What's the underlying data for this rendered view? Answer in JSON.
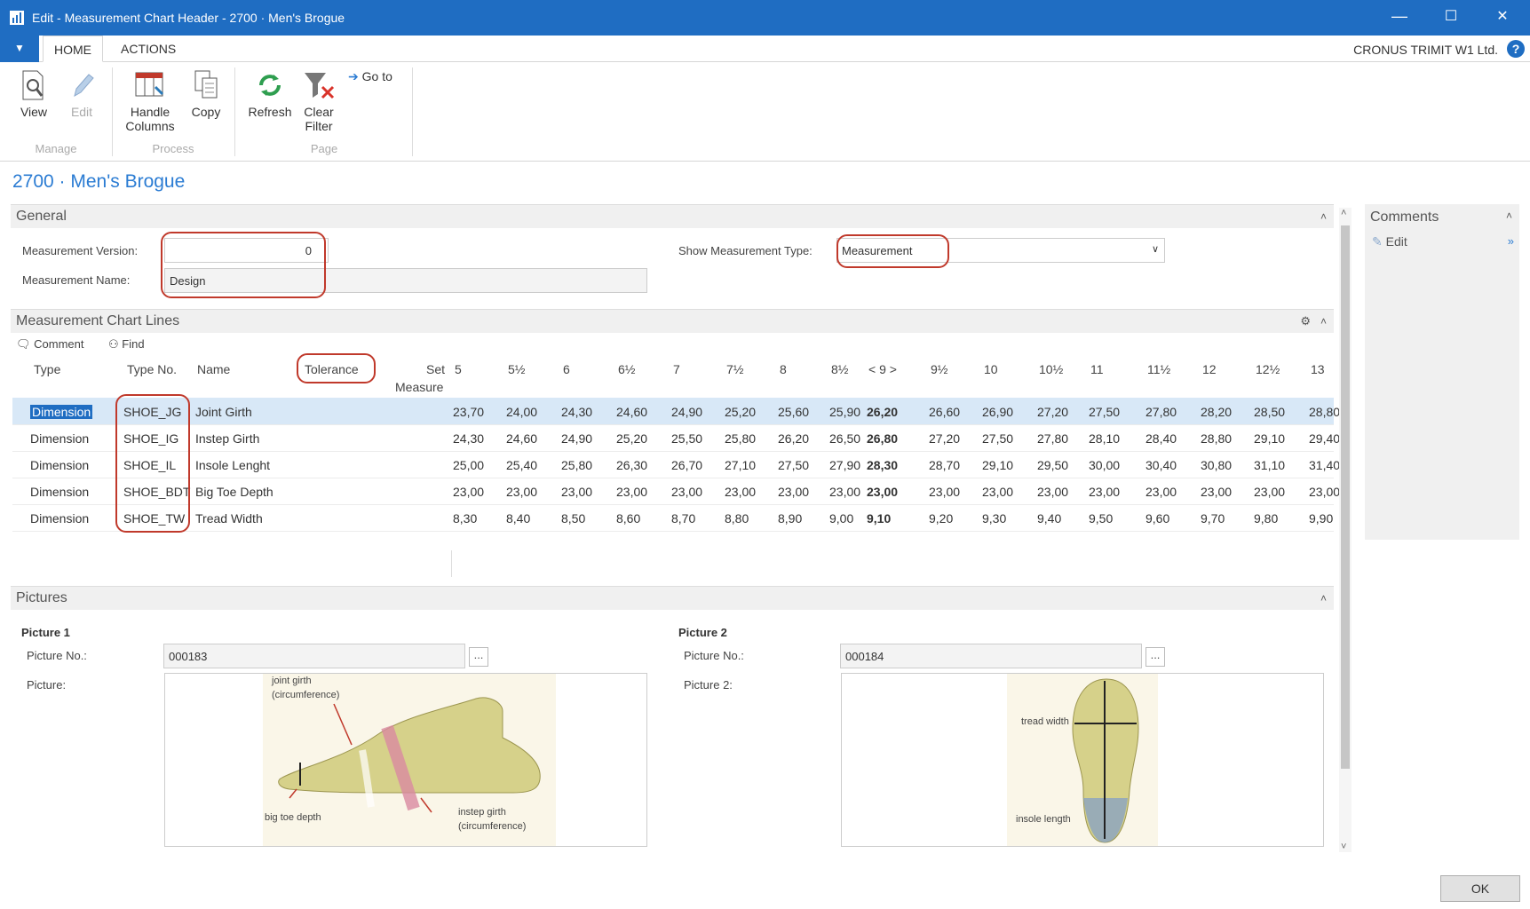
{
  "window": {
    "title": "Edit - Measurement Chart Header - 2700 · Men's Brogue",
    "minimize": "—",
    "maximize": "☐",
    "close": "✕"
  },
  "menubar": {
    "dropdown": "▼",
    "tabs": [
      "HOME",
      "ACTIONS"
    ],
    "company": "CRONUS TRIMIT W1 Ltd.",
    "help": "?"
  },
  "ribbon": {
    "groups": {
      "manage": "Manage",
      "process": "Process",
      "page": "Page"
    },
    "view": "View",
    "edit": "Edit",
    "handle_columns_1": "Handle",
    "handle_columns_2": "Columns",
    "copy": "Copy",
    "refresh": "Refresh",
    "clear_filter_1": "Clear",
    "clear_filter_2": "Filter",
    "goto": "Go to"
  },
  "page_title": "2700 · Men's Brogue",
  "general": {
    "header": "General",
    "version_label": "Measurement Version:",
    "version_value": "0",
    "name_label": "Measurement Name:",
    "name_value": "Design",
    "type_label": "Show Measurement Type:",
    "type_value": "Measurement"
  },
  "lines": {
    "header": "Measurement Chart Lines",
    "toolbar": {
      "comment": "Comment",
      "find": "Find"
    },
    "columns": {
      "type": "Type",
      "type_no": "Type No.",
      "name": "Name",
      "tolerance": "Tolerance",
      "set": "Set",
      "measure": "Measure"
    },
    "sizes": [
      "5",
      "5½",
      "6",
      "6½",
      "7",
      "7½",
      "8",
      "8½",
      "< 9 >",
      "9½",
      "10",
      "10½",
      "11",
      "11½",
      "12",
      "12½",
      "13"
    ],
    "rows": [
      {
        "type": "Dimension",
        "type_no": "SHOE_JG",
        "name": "Joint Girth",
        "values": [
          "23,70",
          "24,00",
          "24,30",
          "24,60",
          "24,90",
          "25,20",
          "25,60",
          "25,90",
          "26,20",
          "26,60",
          "26,90",
          "27,20",
          "27,50",
          "27,80",
          "28,20",
          "28,50",
          "28,80"
        ]
      },
      {
        "type": "Dimension",
        "type_no": "SHOE_IG",
        "name": "Instep Girth",
        "values": [
          "24,30",
          "24,60",
          "24,90",
          "25,20",
          "25,50",
          "25,80",
          "26,20",
          "26,50",
          "26,80",
          "27,20",
          "27,50",
          "27,80",
          "28,10",
          "28,40",
          "28,80",
          "29,10",
          "29,40"
        ]
      },
      {
        "type": "Dimension",
        "type_no": "SHOE_IL",
        "name": "Insole Lenght",
        "values": [
          "25,00",
          "25,40",
          "25,80",
          "26,30",
          "26,70",
          "27,10",
          "27,50",
          "27,90",
          "28,30",
          "28,70",
          "29,10",
          "29,50",
          "30,00",
          "30,40",
          "30,80",
          "31,10",
          "31,40"
        ]
      },
      {
        "type": "Dimension",
        "type_no": "SHOE_BDT",
        "name": "Big Toe Depth",
        "values": [
          "23,00",
          "23,00",
          "23,00",
          "23,00",
          "23,00",
          "23,00",
          "23,00",
          "23,00",
          "23,00",
          "23,00",
          "23,00",
          "23,00",
          "23,00",
          "23,00",
          "23,00",
          "23,00",
          "23,00"
        ]
      },
      {
        "type": "Dimension",
        "type_no": "SHOE_TW",
        "name": "Tread Width",
        "values": [
          "8,30",
          "8,40",
          "8,50",
          "8,60",
          "8,70",
          "8,80",
          "8,90",
          "9,00",
          "9,10",
          "9,20",
          "9,30",
          "9,40",
          "9,50",
          "9,60",
          "9,70",
          "9,80",
          "9,90"
        ]
      }
    ]
  },
  "pictures": {
    "header": "Pictures",
    "p1": {
      "title": "Picture 1",
      "no_label": "Picture No.:",
      "no_value": "000183",
      "pic_label": "Picture:",
      "annotations": {
        "joint_girth_1": "joint girth",
        "joint_girth_2": "(circumference)",
        "big_toe": "big toe depth",
        "instep_1": "instep girth",
        "instep_2": "(circumference)"
      }
    },
    "p2": {
      "title": "Picture 2",
      "no_label": "Picture No.:",
      "no_value": "000184",
      "pic_label": "Picture 2:",
      "annotations": {
        "tread": "tread width",
        "insole": "insole length"
      }
    },
    "ellipsis": "..."
  },
  "comments": {
    "header": "Comments",
    "edit": "Edit",
    "more": "»",
    "collapse": "˄"
  },
  "ok": "OK",
  "colors": {
    "accent": "#1f6dc2",
    "highlight_ring": "#c0392b",
    "selected_row": "#d8e8f7"
  }
}
